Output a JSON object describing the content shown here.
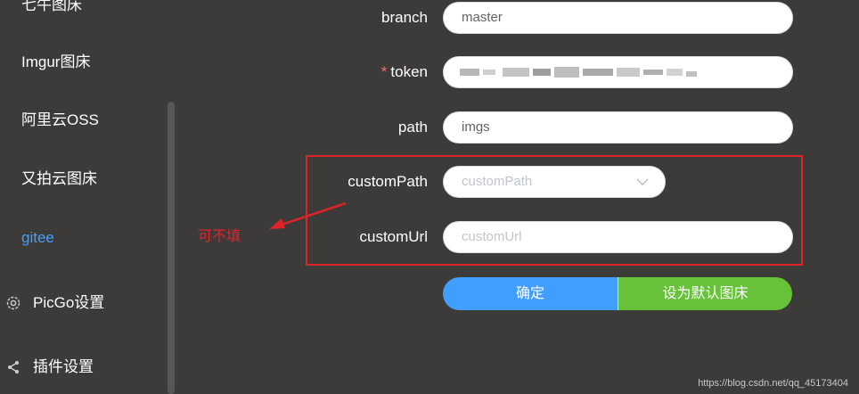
{
  "sidebar": {
    "items": [
      {
        "label": "七牛图床"
      },
      {
        "label": "Imgur图床"
      },
      {
        "label": "阿里云OSS"
      },
      {
        "label": "又拍云图床"
      },
      {
        "label": "gitee"
      },
      {
        "label": "PicGo设置",
        "icon": "gear-icon"
      },
      {
        "label": "插件设置",
        "icon": "share-icon"
      }
    ],
    "active_item": "gitee"
  },
  "form": {
    "branch": {
      "label": "branch",
      "value": "master"
    },
    "token": {
      "label": "token",
      "required_mark": "*",
      "value": "(obscured)"
    },
    "path": {
      "label": "path",
      "value": "imgs"
    },
    "customPath": {
      "label": "customPath",
      "placeholder": "customPath"
    },
    "customUrl": {
      "label": "customUrl",
      "placeholder": "customUrl"
    }
  },
  "annotation": {
    "text": "可不填",
    "color": "#e0232a"
  },
  "buttons": {
    "confirm": "确定",
    "set_default": "设为默认图床"
  },
  "watermark": "https://blog.csdn.net/qq_45173404",
  "colors": {
    "background": "#3d3b39",
    "active": "#409eff",
    "confirm": "#409eff",
    "set_default": "#67c23a",
    "required": "#f56c6c",
    "annotation": "#e0232a"
  }
}
